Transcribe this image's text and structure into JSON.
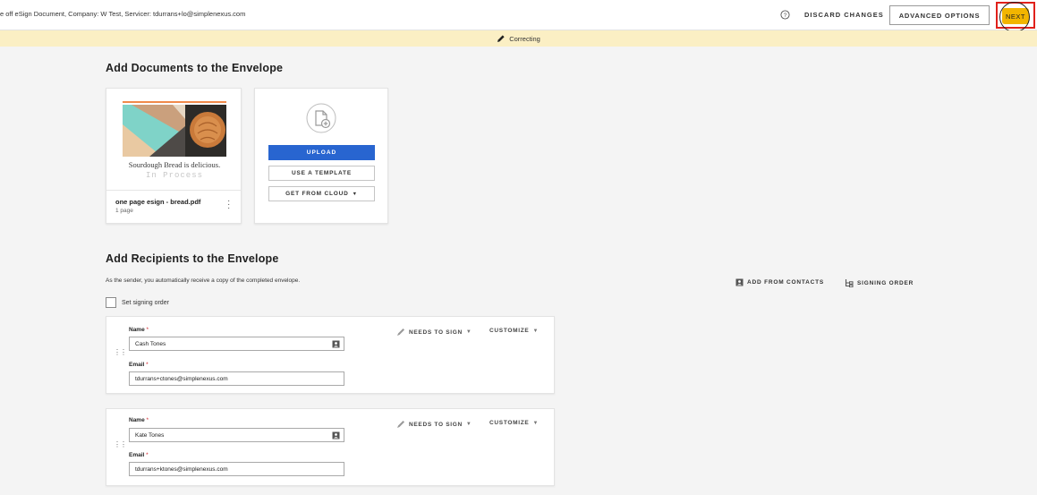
{
  "header": {
    "title": "e off eSign Document, Company: W Test, Servicer: tdurrans+lo@simplenexus.com",
    "discard_label": "DISCARD CHANGES",
    "advanced_label": "ADVANCED OPTIONS",
    "next_label": "NEXT"
  },
  "banner": {
    "status": "Correcting"
  },
  "documents": {
    "heading": "Add Documents to the Envelope",
    "items": [
      {
        "thumb_caption": "Sourdough Bread is delicious.",
        "watermark": "In Process",
        "name": "one page esign - bread.pdf",
        "pages": "1 page"
      }
    ],
    "upload_label": "UPLOAD",
    "template_label": "USE A TEMPLATE",
    "cloud_label": "GET FROM CLOUD",
    "cloud_caret": "▼"
  },
  "recipients": {
    "heading": "Add Recipients to the Envelope",
    "sender_note": "As the sender, you automatically receive a copy of the completed envelope.",
    "add_contacts_label": "ADD FROM CONTACTS",
    "signing_order_label": "SIGNING ORDER",
    "set_order_label": "Set signing order",
    "name_label": "Name",
    "email_label": "Email",
    "required_mark": "*",
    "needs_to_sign_label": "NEEDS TO SIGN",
    "customize_label": "CUSTOMIZE",
    "caret": "▼",
    "list": [
      {
        "name": "Cash Tones",
        "email": "tdurrans+ctones@simplenexus.com"
      },
      {
        "name": "Kate Tones",
        "email": "tdurrans+ktones@simplenexus.com"
      }
    ]
  },
  "colors": {
    "accent_blue": "#2865d0",
    "next_yellow": "#f2b500",
    "banner_bg": "#fbefc4",
    "highlight_red": "#e0211b"
  },
  "icons": [
    "help-icon",
    "pencil-icon",
    "add-document-icon",
    "contact-card-icon",
    "signing-order-icon",
    "pen-icon",
    "drag-handle-icon",
    "kebab-menu-icon"
  ]
}
